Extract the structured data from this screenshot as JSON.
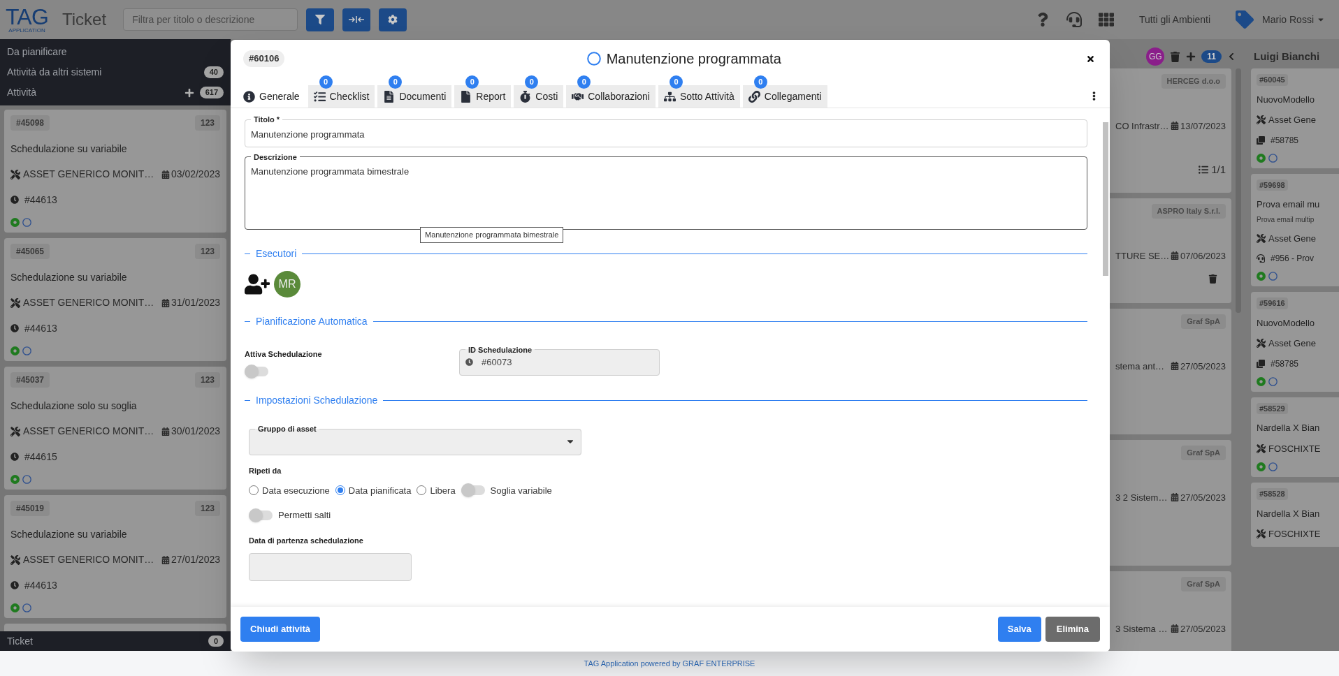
{
  "topbar": {
    "logo": "TAG",
    "logo_sub": "APPLICATION",
    "title": "Ticket",
    "search": {
      "placeholder": "Filtra per titolo o descrizione"
    },
    "environment": "Tutti gli Ambienti",
    "user": "Mario Rossi"
  },
  "sidebar": {
    "sections": [
      {
        "label": "Da pianificare"
      },
      {
        "label": "Attività da altri sistemi",
        "count": "40",
        "add": false
      },
      {
        "label": "Attività",
        "count": "617",
        "add": true
      }
    ],
    "cards": [
      {
        "id": "#45098",
        "count": "123",
        "title": "Schedulazione su variabile",
        "asset": "ASSET GENERICO MONIT…",
        "date": "03/02/2023",
        "ref": "#44613"
      },
      {
        "id": "#45065",
        "count": "123",
        "title": "Schedulazione su variabile",
        "asset": "ASSET GENERICO MONIT…",
        "date": "31/01/2023",
        "ref": "#44613"
      },
      {
        "id": "#45037",
        "count": "123",
        "title": "Schedulazione solo su soglia",
        "asset": "ASSET GENERICO MONIT…",
        "date": "30/01/2023",
        "ref": "#44615"
      },
      {
        "id": "#45019",
        "count": "123",
        "title": "Schedulazione su variabile",
        "asset": "ASSET GENERICO MONIT…",
        "date": "27/01/2023",
        "ref": "#44613"
      }
    ],
    "footer": {
      "label": "Ticket",
      "count": "0"
    }
  },
  "middle_column": {
    "avatar": "GG",
    "count": "11",
    "cards": [
      {
        "company": "HERCEG d.o.o",
        "asset": "CO Infrastr…",
        "date": "13/07/2023",
        "progress": "1/1",
        "deletable": false
      },
      {
        "company": "ASPRO Italy S.r.l.",
        "asset": "TTURE SE…",
        "date": "07/06/2023",
        "deletable": true
      },
      {
        "company": "Graf SpA",
        "asset": "stema ant…",
        "date": "27/05/2023",
        "deletable": false
      },
      {
        "company": "Graf SpA",
        "asset": "3 2 Sistem…",
        "date": "27/05/2023",
        "deletable": false
      },
      {
        "company": "Graf SpA",
        "asset": "3 Sistema …",
        "date": "27/05/2023",
        "deletable": false
      }
    ]
  },
  "right_column": {
    "title": "Luigi Bianchi",
    "cards": [
      {
        "id": "#60045",
        "title": "NuovoModello",
        "asset": "Asset Gene",
        "ref": {
          "kind": "copy",
          "text": "#58785"
        }
      },
      {
        "id": "#59698",
        "title": "Prova email mu",
        "subtitle": "Prova email multip",
        "asset": "Asset Gene",
        "ref": {
          "kind": "headset",
          "text": "#956 - Prov"
        }
      },
      {
        "id": "#59616",
        "title": "NuovoModello",
        "asset": "Asset Gene",
        "ref": {
          "kind": "copy",
          "text": "#58785"
        }
      },
      {
        "id": "#58529",
        "title": "Nardella X Bian",
        "asset": "FOSCHIXTE"
      },
      {
        "id": "#58528",
        "title": "Nardella X Bian",
        "asset": "FOSCHIXTE"
      }
    ]
  },
  "modal": {
    "id": "#60106",
    "title": "Manutenzione programmata",
    "tabs": [
      {
        "label": "Generale",
        "selected": true
      },
      {
        "label": "Checklist",
        "count": "0",
        "selected": false
      },
      {
        "label": "Documenti",
        "count": "0",
        "selected": false
      },
      {
        "label": "Report",
        "count": "0",
        "selected": false
      },
      {
        "label": "Costi",
        "count": "0",
        "selected": false
      },
      {
        "label": "Collaborazioni",
        "count": "0",
        "selected": false
      },
      {
        "label": "Sotto Attività",
        "count": "0",
        "selected": false
      },
      {
        "label": "Collegamenti",
        "count": "0",
        "selected": false
      }
    ],
    "titolo": {
      "label": "Titolo *",
      "value": "Manutenzione programmata"
    },
    "descrizione": {
      "label": "Descrizione",
      "value": "Manutenzione programmata bimestrale",
      "tooltip": "Manutenzione programmata bimestrale"
    },
    "esecutori": {
      "heading": "Esecutori",
      "members": [
        "MR"
      ]
    },
    "pianificazione": {
      "heading": "Pianificazione Automatica",
      "toggle": {
        "label": "Attiva Schedulazione",
        "on": false
      },
      "id_field": {
        "label": "ID Schedulazione",
        "value": "#60073"
      }
    },
    "impostazioni": {
      "heading": "Impostazioni Schedulazione",
      "gruppo": {
        "label": "Gruppo di asset"
      },
      "ripeti": {
        "label": "Ripeti da",
        "options": [
          {
            "label": "Data esecuzione",
            "selected": false
          },
          {
            "label": "Data pianificata",
            "selected": true
          },
          {
            "label": "Libera",
            "selected": false
          }
        ]
      },
      "soglia": {
        "label": "Soglia variabile",
        "on": false
      },
      "salti": {
        "label": "Permetti salti",
        "on": false
      },
      "partenza": {
        "label": "Data di partenza schedulazione"
      }
    },
    "buttons": {
      "close": "Chiudi attività",
      "save": "Salva",
      "delete": "Elimina"
    }
  },
  "footer": "TAG Application powered by GRAF ENTERPRISE"
}
